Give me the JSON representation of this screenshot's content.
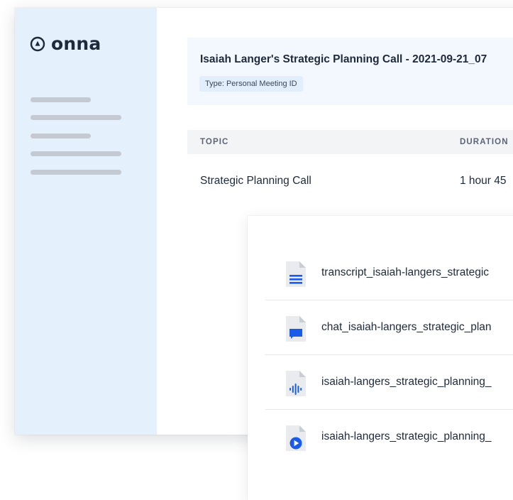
{
  "app": {
    "logo_text": "onna",
    "logo_icon": "onna-logo-icon"
  },
  "meeting": {
    "title": "Isaiah Langer's Strategic Planning Call - 2021-09-21_07",
    "type_badge": "Type: Personal Meeting ID"
  },
  "table": {
    "columns": [
      "TOPIC",
      "DURATION"
    ],
    "rows": [
      {
        "topic": "Strategic Planning Call",
        "duration": "1 hour 45"
      }
    ]
  },
  "files": [
    {
      "name": "transcript_isaiah-langers_strategic",
      "icon": "transcript-doc-icon"
    },
    {
      "name": "chat_isaiah-langers_strategic_plan",
      "icon": "chat-doc-icon"
    },
    {
      "name": "isaiah-langers_strategic_planning_",
      "icon": "audio-file-icon"
    },
    {
      "name": "isaiah-langers_strategic_planning_",
      "icon": "video-file-icon"
    }
  ],
  "colors": {
    "sidebar_bg": "#e4f1fc",
    "accent_blue": "#1a5ce8",
    "text_dark": "#1e2a3b",
    "placeholder_gray": "#c4c9d2"
  }
}
